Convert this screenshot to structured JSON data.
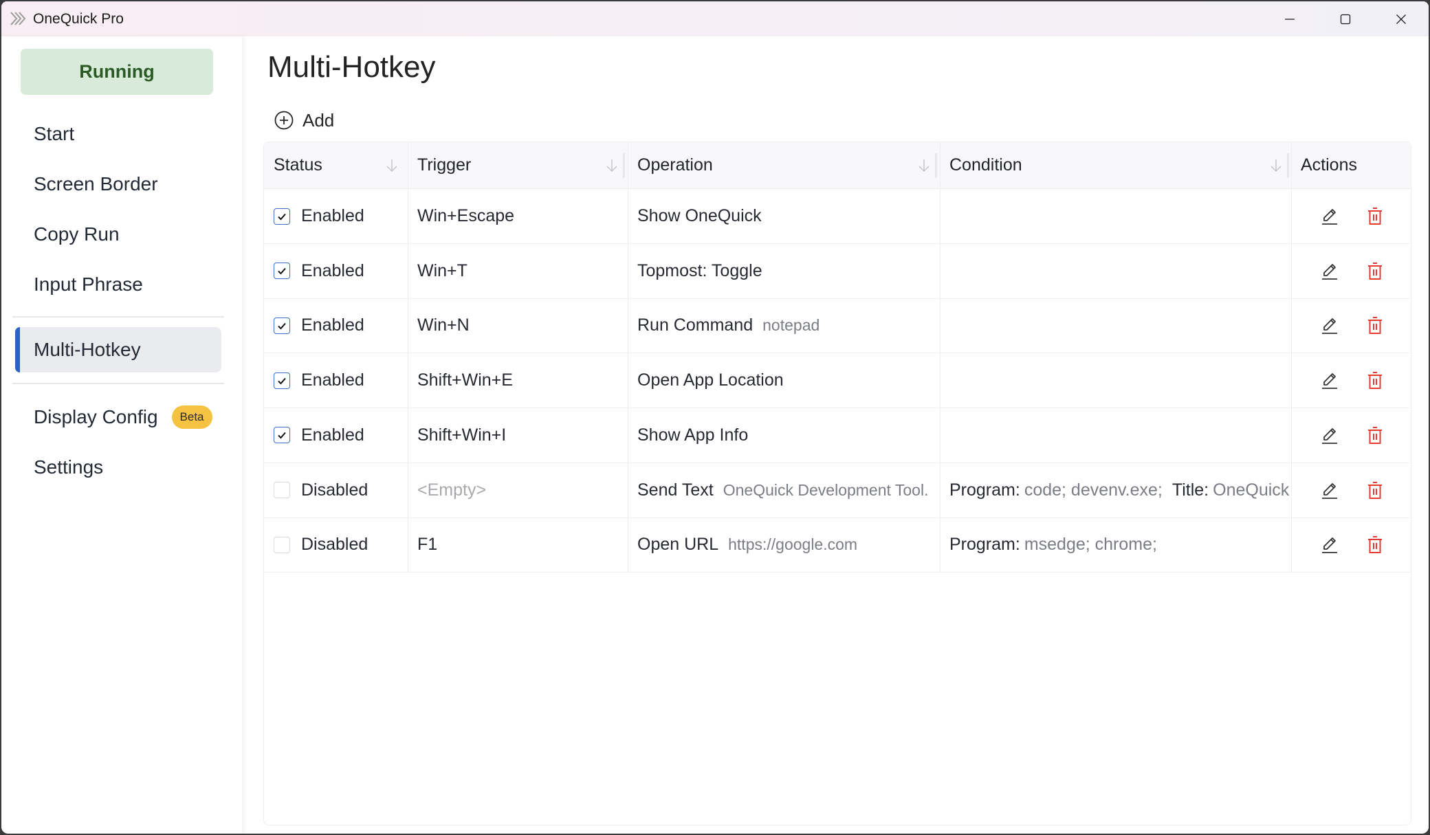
{
  "window": {
    "title": "OneQuick Pro",
    "controls": {
      "minimize": "minimize",
      "maximize": "maximize",
      "close": "close"
    }
  },
  "sidebar": {
    "status_button": "Running",
    "items": [
      {
        "label": "Start"
      },
      {
        "label": "Screen Border"
      },
      {
        "label": "Copy Run"
      },
      {
        "label": "Input Phrase"
      },
      {
        "label": "Multi-Hotkey",
        "active": true
      },
      {
        "label": "Display Config",
        "badge": "Beta"
      },
      {
        "label": "Settings"
      }
    ]
  },
  "main": {
    "title": "Multi-Hotkey",
    "add_label": "Add",
    "table": {
      "columns": [
        "Status",
        "Trigger",
        "Operation",
        "Condition",
        "Actions"
      ],
      "rows": [
        {
          "checked": true,
          "status": "Enabled",
          "trigger": "Win+Escape",
          "trigger_empty": false,
          "operation": "Show OneQuick",
          "operation_arg": "",
          "condition": []
        },
        {
          "checked": true,
          "status": "Enabled",
          "trigger": "Win+T",
          "trigger_empty": false,
          "operation": "Topmost: Toggle",
          "operation_arg": "",
          "condition": []
        },
        {
          "checked": true,
          "status": "Enabled",
          "trigger": "Win+N",
          "trigger_empty": false,
          "operation": "Run Command",
          "operation_arg": "notepad",
          "condition": []
        },
        {
          "checked": true,
          "status": "Enabled",
          "trigger": "Shift+Win+E",
          "trigger_empty": false,
          "operation": "Open App Location",
          "operation_arg": "",
          "condition": []
        },
        {
          "checked": true,
          "status": "Enabled",
          "trigger": "Shift+Win+I",
          "trigger_empty": false,
          "operation": "Show App Info",
          "operation_arg": "",
          "condition": []
        },
        {
          "checked": false,
          "status": "Disabled",
          "trigger": "<Empty>",
          "trigger_empty": true,
          "operation": "Send Text",
          "operation_arg": "OneQuick Development Tool.",
          "condition": [
            {
              "key": "Program:",
              "value": "code; devenv.exe;"
            },
            {
              "key": "Title:",
              "value": "OneQuick"
            }
          ]
        },
        {
          "checked": false,
          "status": "Disabled",
          "trigger": "F1",
          "trigger_empty": false,
          "operation": "Open URL",
          "operation_arg": "https://google.com",
          "condition": [
            {
              "key": "Program:",
              "value": "msedge; chrome;"
            }
          ]
        }
      ],
      "actions": {
        "edit": "edit-icon",
        "delete": "delete-icon"
      }
    }
  },
  "colors": {
    "running_bg": "#d8ebdb",
    "running_text": "#2b5a24",
    "accent": "#2d63c0",
    "delete": "#e53935",
    "beta_badge": "#f5c242"
  }
}
